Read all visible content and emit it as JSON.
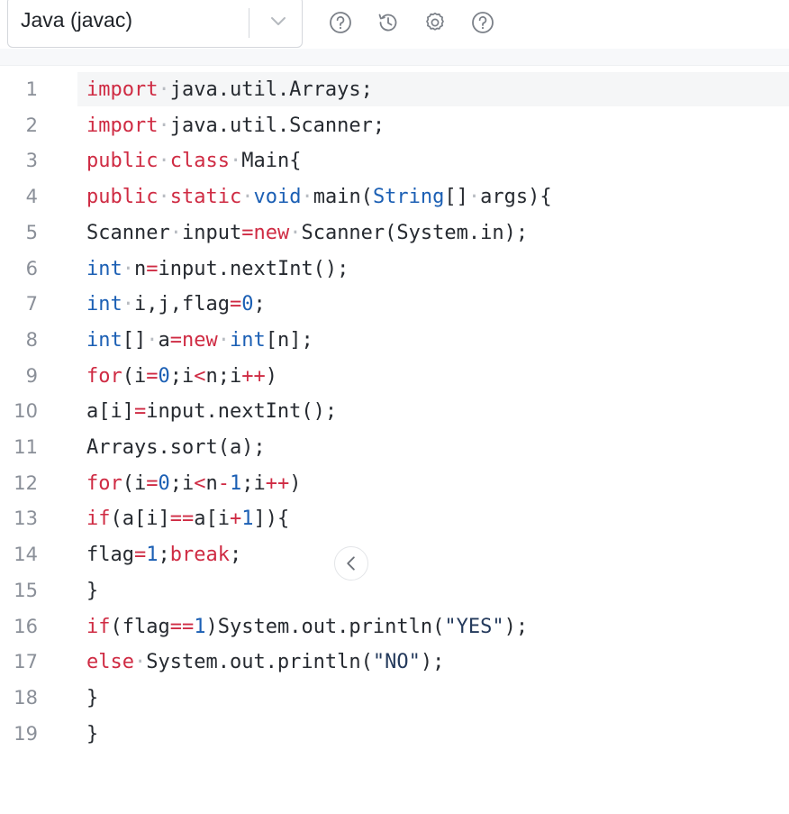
{
  "toolbar": {
    "language_selected": "Java (javac)",
    "icons": [
      "help-circle-icon",
      "history-icon",
      "settings-gear-icon",
      "help-circle-icon"
    ]
  },
  "editor": {
    "line_numbers": [
      "1",
      "2",
      "3",
      "4",
      "5",
      "6",
      "7",
      "8",
      "9",
      "10",
      "11",
      "12",
      "13",
      "14",
      "15",
      "16",
      "17",
      "18",
      "19"
    ],
    "lines": [
      "import java.util.Arrays;",
      "import java.util.Scanner;",
      "public class Main{",
      "public static void main(String[] args){",
      "Scanner input=new Scanner(System.in);",
      "int n=input.nextInt();",
      "int i,j,flag=0;",
      "int[] a=new int[n];",
      "for(i=0;i<n;i++)",
      "a[i]=input.nextInt();",
      "Arrays.sort(a);",
      "for(i=0;i<n-1;i++)",
      "if(a[i]==a[i+1]){",
      "flag=1;break;",
      "}",
      "if(flag==1)System.out.println(\"YES\");",
      "else System.out.println(\"NO\");",
      "}",
      "}"
    ],
    "active_line": 1
  },
  "colors": {
    "keyword": "#cf2b43",
    "type": "#1b5fb4",
    "string": "#243a5c",
    "default": "#262a30"
  }
}
